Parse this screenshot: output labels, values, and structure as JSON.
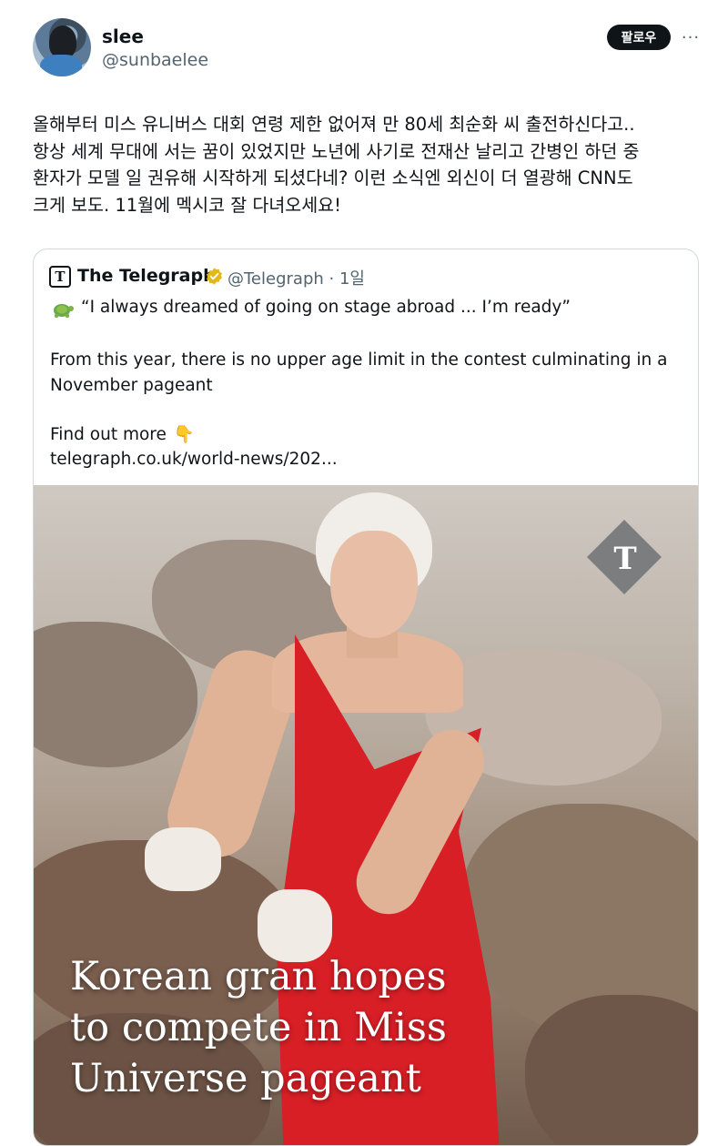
{
  "author": {
    "display_name": "slee",
    "handle": "@sunbaelee",
    "avatar_icon": "profile-avatar"
  },
  "actions": {
    "follow_label": "팔로우",
    "more_icon": "more-horizontal-icon",
    "more_glyph": "···"
  },
  "tweet": {
    "lines": [
      "올해부터 미스 유니버스 대회 연령 제한 없어져 만 80세 최순화 씨 출전하신다고..",
      "항상 세계 무대에 서는 꿈이 있었지만 노년에 사기로 전재산 날리고 간병인 하던 중",
      "환자가 모델 일 권유해 시작하게 되셨다네? 이런 소식엔 외신이 더 열광해 CNN도",
      "크게 보도. 11월에 멕시코 잘 다녀오세요!"
    ]
  },
  "quote": {
    "name": "The Telegraph",
    "logo_letter": "T",
    "verified_icon": "verified-badge-icon",
    "verified_color": "#e2b719",
    "handle_time": "@Telegraph · 1일",
    "line1": "“I always dreamed of going on stage abroad ... I’m ready”",
    "paragraph": "From this year, there is no upper age limit in the contest culminating in a November pageant",
    "find_more": "Find out more",
    "hand_emoji": "👇",
    "link": "telegraph.co.uk/world-news/202...",
    "image": {
      "badge_letter": "T",
      "headline_lines": [
        "Korean gran hopes",
        "to compete in Miss",
        "Universe pageant"
      ],
      "dress_color": "#d81f26"
    }
  }
}
